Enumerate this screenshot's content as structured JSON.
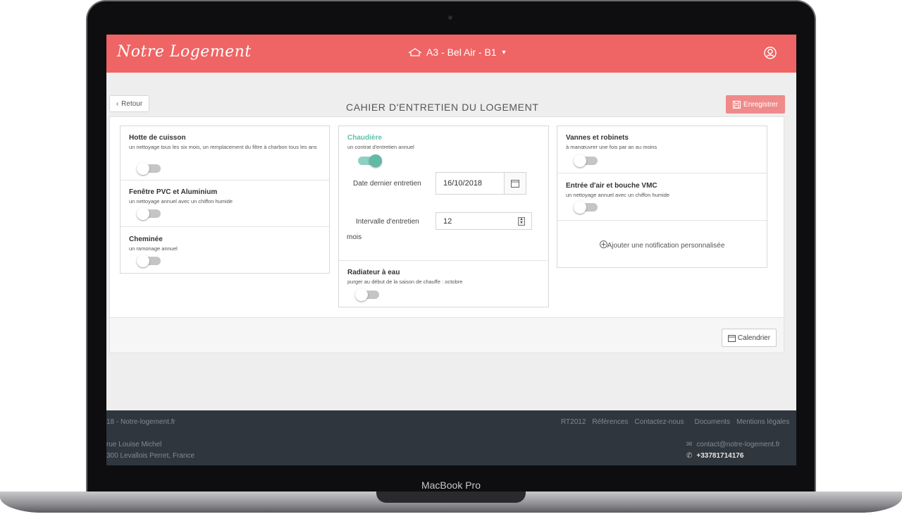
{
  "device": {
    "label": "MacBook Pro"
  },
  "header": {
    "logo": "Notre Logement",
    "location": "A3 - Bel Air - B1",
    "icons": {
      "home": "home-icon",
      "caret": "caret-down-icon",
      "user": "user-icon"
    }
  },
  "toolbar": {
    "back_label": "Retour",
    "title": "CAHIER D'ENTRETIEN DU LOGEMENT",
    "save_label": "Enregistrer"
  },
  "columns": {
    "left": [
      {
        "title": "Hotte de cuisson",
        "desc": "un nettoyage tous les six mois, un remplacement du filtre à charbon tous les ans",
        "enabled": false
      },
      {
        "title": "Fenêtre PVC et Aluminium",
        "desc": "un nettoyage annuel avec un chiffon humide",
        "enabled": false
      },
      {
        "title": "Cheminée",
        "desc": "un ramonage annuel",
        "enabled": false
      }
    ],
    "middle": {
      "boiler": {
        "title": "Chaudière",
        "desc": "un contrat d'entretien annuel",
        "enabled": true,
        "last_service_label": "Date dernier entretien",
        "last_service_value": "16/10/2018",
        "interval_label": "Intervalle d'entretien",
        "interval_value": "12",
        "interval_unit": "mois"
      },
      "radiator": {
        "title": "Radiateur à eau",
        "desc": "purger au début de la saison de chauffe : octobre",
        "enabled": false
      }
    },
    "right": [
      {
        "title": "Vannes et robinets",
        "desc": "à manœuvrer une fois par an au moins",
        "enabled": false
      },
      {
        "title": "Entrée d'air et bouche VMC",
        "desc": "un nettoyage annuel avec un chiffon humide",
        "enabled": false
      }
    ],
    "add_notification": "Ajouter une notification personnalisée"
  },
  "panel_footer": {
    "calendar_label": "Calendrier"
  },
  "footer": {
    "copyright": "18 - Notre-logement.fr",
    "links": [
      "RT2012",
      "Références",
      "Contactez-nous",
      "Documents",
      "Mentions légales"
    ],
    "address_line1": "rue Louise Michel",
    "address_line2": "300 Levallois Perret, France",
    "email": "contact@notre-logement.fr",
    "phone": "+33781714176"
  },
  "colors": {
    "brand": "#ef6464",
    "accent_green": "#5fbfaa",
    "footer_bg": "#30363d"
  }
}
